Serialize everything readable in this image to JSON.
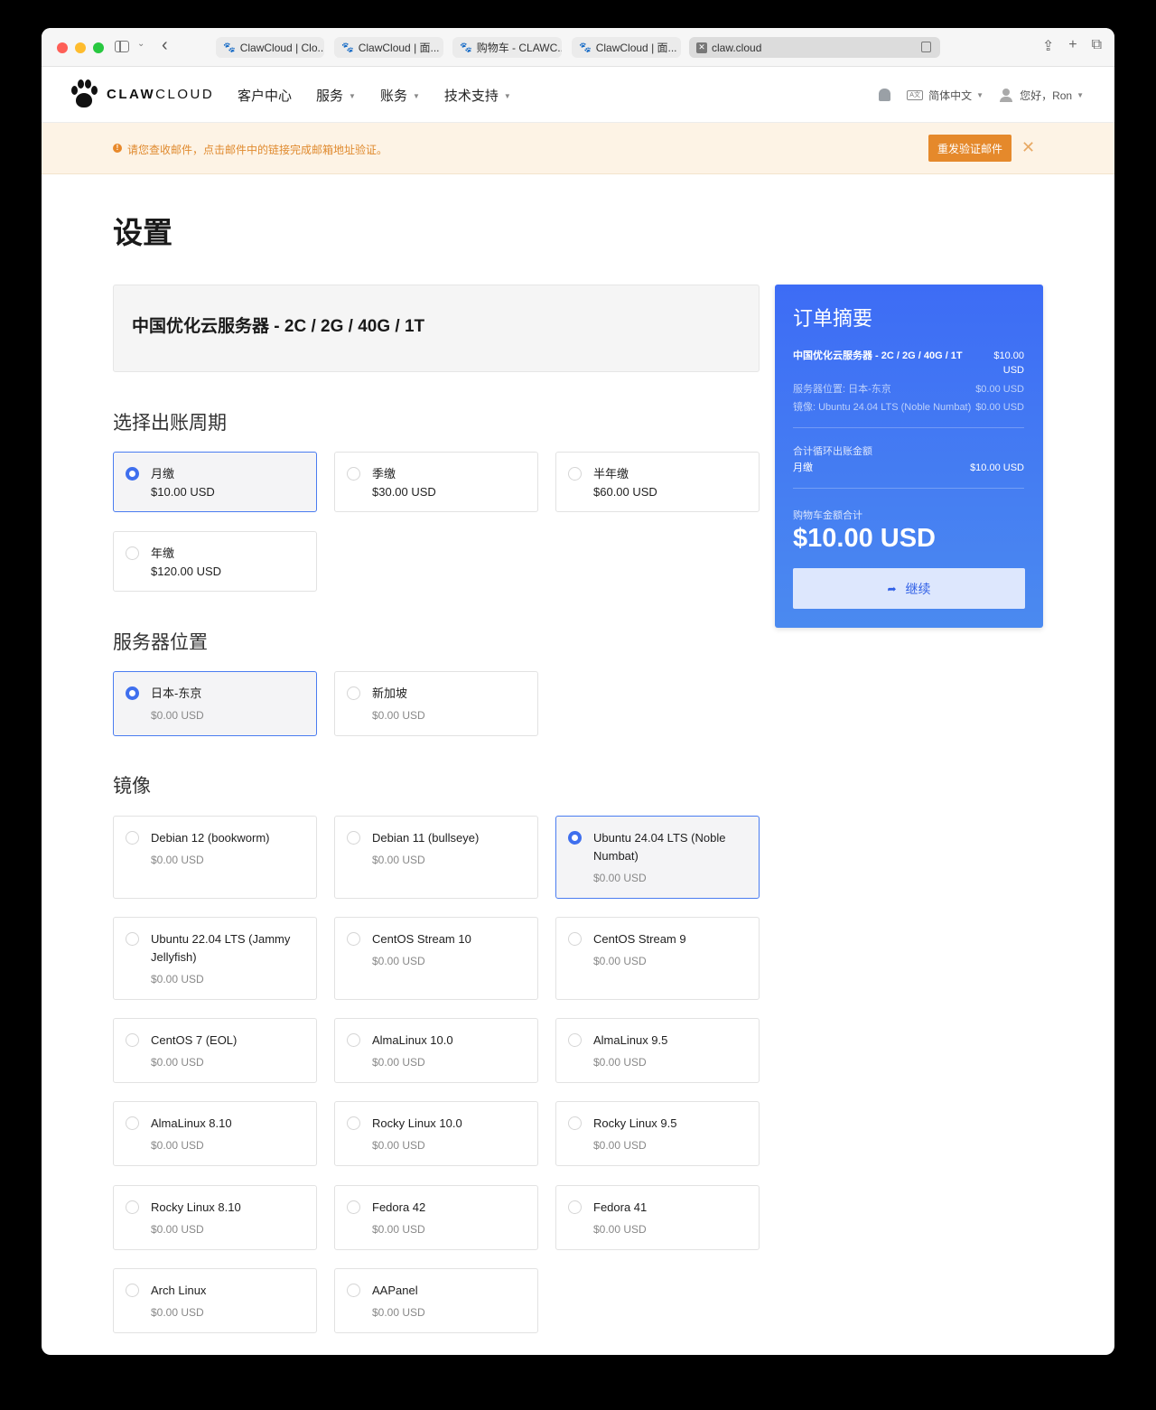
{
  "browser": {
    "tabs": [
      {
        "title": "ClawCloud | Clo..."
      },
      {
        "title": "ClawCloud | 面..."
      },
      {
        "title": "购物车 - CLAWC..."
      },
      {
        "title": "ClawCloud | 面..."
      }
    ],
    "address": "claw.cloud"
  },
  "nav": {
    "logo_bold": "CLAW",
    "logo_light": "CLOUD",
    "menu": [
      "客户中心",
      "服务",
      "账务",
      "技术支持"
    ],
    "language": "简体中文",
    "language_icon": "A文",
    "greeting": "您好，Ron"
  },
  "alert": {
    "message": "请您查收邮件，点击邮件中的链接完成邮箱地址验证。",
    "button": "重发验证邮件",
    "close": "✕"
  },
  "page": {
    "title": "设置",
    "product_name": "中国优化云服务器 - 2C / 2G / 40G / 1T"
  },
  "billing": {
    "title": "选择出账周期",
    "options": [
      {
        "label": "月缴",
        "price": "$10.00 USD",
        "selected": true
      },
      {
        "label": "季缴",
        "price": "$30.00 USD",
        "selected": false
      },
      {
        "label": "半年缴",
        "price": "$60.00 USD",
        "selected": false
      },
      {
        "label": "年缴",
        "price": "$120.00 USD",
        "selected": false
      }
    ]
  },
  "location": {
    "title": "服务器位置",
    "options": [
      {
        "label": "日本-东京",
        "price": "$0.00 USD",
        "selected": true
      },
      {
        "label": "新加坡",
        "price": "$0.00 USD",
        "selected": false
      }
    ]
  },
  "image": {
    "title": "镜像",
    "options": [
      {
        "label": "Debian 12 (bookworm)",
        "price": "$0.00 USD"
      },
      {
        "label": "Debian 11 (bullseye)",
        "price": "$0.00 USD"
      },
      {
        "label": "Ubuntu 24.04 LTS (Noble Numbat)",
        "price": "$0.00 USD",
        "selected": true
      },
      {
        "label": "Ubuntu 22.04 LTS (Jammy Jellyfish)",
        "price": "$0.00 USD"
      },
      {
        "label": "CentOS Stream 10",
        "price": "$0.00 USD"
      },
      {
        "label": "CentOS Stream 9",
        "price": "$0.00 USD"
      },
      {
        "label": "CentOS 7 (EOL)",
        "price": "$0.00 USD"
      },
      {
        "label": "AlmaLinux 10.0",
        "price": "$0.00 USD"
      },
      {
        "label": "AlmaLinux 9.5",
        "price": "$0.00 USD"
      },
      {
        "label": "AlmaLinux 8.10",
        "price": "$0.00 USD"
      },
      {
        "label": "Rocky Linux 10.0",
        "price": "$0.00 USD"
      },
      {
        "label": "Rocky Linux 9.5",
        "price": "$0.00 USD"
      },
      {
        "label": "Rocky Linux 8.10",
        "price": "$0.00 USD"
      },
      {
        "label": "Fedora 42",
        "price": "$0.00 USD"
      },
      {
        "label": "Fedora 41",
        "price": "$0.00 USD"
      },
      {
        "label": "Arch Linux",
        "price": "$0.00 USD"
      },
      {
        "label": "AAPanel",
        "price": "$0.00 USD"
      }
    ]
  },
  "summary": {
    "title": "订单摘要",
    "product_line": "中国优化云服务器 - 2C / 2G / 40G / 1T",
    "product_price": "$10.00 USD",
    "location_line": "服务器位置: 日本-东京",
    "location_price": "$0.00 USD",
    "image_line": "镜像: Ubuntu 24.04 LTS (Noble Numbat)",
    "image_price": "$0.00 USD",
    "recurring_label": "合计循环出账金额",
    "recurring_cycle": "月缴",
    "recurring_price": "$10.00 USD",
    "total_label": "购物车金额合计",
    "total": "$10.00 USD",
    "continue": "继续"
  },
  "colors": {
    "accent": "#3f6fee",
    "alert_bg": "#fdf3e5",
    "alert_button": "#e5892b",
    "summary_top": "#3d6cf5",
    "summary_bottom": "#4b8af0"
  }
}
